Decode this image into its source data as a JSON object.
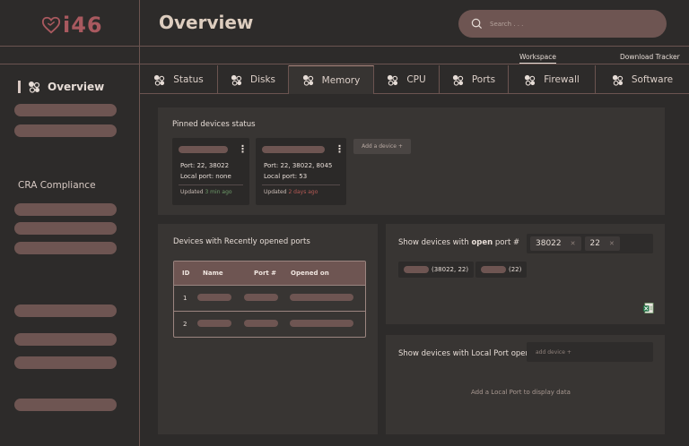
{
  "app": {
    "logo_text": "i46",
    "page_title": "Overview"
  },
  "search": {
    "placeholder": "Search . . ."
  },
  "subnav": {
    "workspace": "Workspace",
    "download": "Download Tracker"
  },
  "sidebar": {
    "title": "Overview",
    "section": "CRA Compliance"
  },
  "tabs": [
    "Status",
    "Disks",
    "Memory",
    "CPU",
    "Ports",
    "Firewall",
    "Software"
  ],
  "active_tab": "Memory",
  "pinned": {
    "title": "Pinned devices status",
    "add_label": "Add a device +",
    "cards": [
      {
        "port": "Port:  22, 38022",
        "local": "Local port:  none",
        "updated_prefix": "Updated ",
        "updated_value": "3 min ago"
      },
      {
        "port": "Port:  22, 38022, 8045",
        "local": "Local port:  53",
        "updated_prefix": "Updated ",
        "updated_value": "2 days ago"
      }
    ]
  },
  "recent": {
    "title": "Devices with Recently opened ports",
    "columns": [
      "ID",
      "Name",
      "Port #",
      "Opened on"
    ],
    "rows": [
      "1",
      "2"
    ]
  },
  "open_port": {
    "title_prefix": "Show devices with ",
    "title_bold": "open",
    "title_suffix": " port #",
    "chips": [
      "38022",
      "22"
    ],
    "results": [
      "(38022, 22)",
      "(22)"
    ]
  },
  "local_port": {
    "title": "Show devices with Local Port open",
    "select_placeholder": "add device +",
    "empty_text": "Add a Local Port to display data"
  },
  "colors": {
    "accent": "#6e5552",
    "brand": "#a9595f",
    "success": "#6d9a68",
    "danger": "#b65a55"
  }
}
